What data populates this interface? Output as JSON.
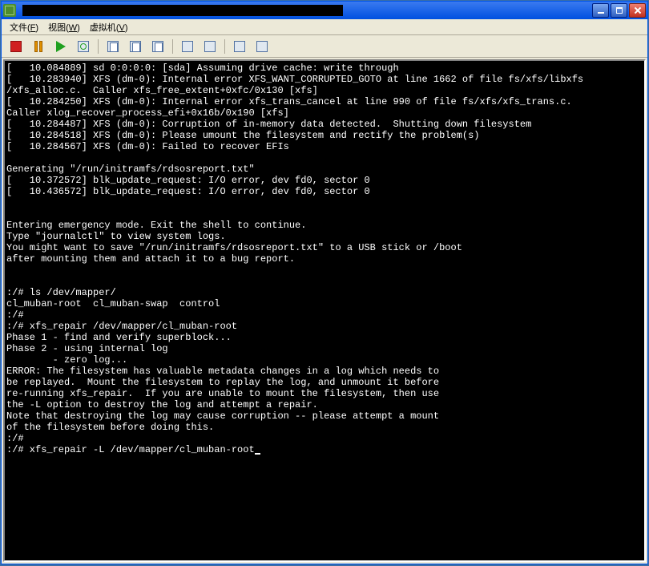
{
  "window": {
    "title_redacted": true
  },
  "menubar": {
    "items": [
      {
        "label": "文件",
        "key": "F"
      },
      {
        "label": "视图",
        "key": "W"
      },
      {
        "label": "虚拟机",
        "key": "V"
      }
    ]
  },
  "toolbar": {
    "buttons": [
      {
        "name": "stop",
        "title": "Stop"
      },
      {
        "name": "pause",
        "title": "Pause"
      },
      {
        "name": "play",
        "title": "Play"
      },
      {
        "name": "refresh",
        "title": "Reset"
      },
      {
        "sep": true
      },
      {
        "name": "snapshot-take",
        "title": "Snapshot"
      },
      {
        "name": "snapshot-revert",
        "title": "Revert"
      },
      {
        "name": "snapshot-manage",
        "title": "Manage"
      },
      {
        "sep": true
      },
      {
        "name": "fullscreen",
        "title": "Fullscreen"
      },
      {
        "name": "view-cycle",
        "title": "View"
      },
      {
        "sep": true
      },
      {
        "name": "tools-a",
        "title": "Tool"
      },
      {
        "name": "tools-b",
        "title": "Tool"
      }
    ]
  },
  "terminal": {
    "lines": [
      "[   10.084889] sd 0:0:0:0: [sda] Assuming drive cache: write through",
      "[   10.283940] XFS (dm-0): Internal error XFS_WANT_CORRUPTED_GOTO at line 1662 of file fs/xfs/libxfs",
      "/xfs_alloc.c.  Caller xfs_free_extent+0xfc/0x130 [xfs]",
      "[   10.284250] XFS (dm-0): Internal error xfs_trans_cancel at line 990 of file fs/xfs/xfs_trans.c.",
      "Caller xlog_recover_process_efi+0x16b/0x190 [xfs]",
      "[   10.284487] XFS (dm-0): Corruption of in-memory data detected.  Shutting down filesystem",
      "[   10.284518] XFS (dm-0): Please umount the filesystem and rectify the problem(s)",
      "[   10.284567] XFS (dm-0): Failed to recover EFIs",
      "",
      "Generating \"/run/initramfs/rdsosreport.txt\"",
      "[   10.372572] blk_update_request: I/O error, dev fd0, sector 0",
      "[   10.436572] blk_update_request: I/O error, dev fd0, sector 0",
      "",
      "",
      "Entering emergency mode. Exit the shell to continue.",
      "Type \"journalctl\" to view system logs.",
      "You might want to save \"/run/initramfs/rdsosreport.txt\" to a USB stick or /boot",
      "after mounting them and attach it to a bug report.",
      "",
      "",
      ":/# ls /dev/mapper/",
      "cl_muban-root  cl_muban-swap  control",
      ":/#",
      ":/# xfs_repair /dev/mapper/cl_muban-root",
      "Phase 1 - find and verify superblock...",
      "Phase 2 - using internal log",
      "        - zero log...",
      "ERROR: The filesystem has valuable metadata changes in a log which needs to",
      "be replayed.  Mount the filesystem to replay the log, and unmount it before",
      "re-running xfs_repair.  If you are unable to mount the filesystem, then use",
      "the -L option to destroy the log and attempt a repair.",
      "Note that destroying the log may cause corruption -- please attempt a mount",
      "of the filesystem before doing this.",
      ":/#",
      ":/# xfs_repair -L /dev/mapper/cl_muban-root"
    ]
  }
}
